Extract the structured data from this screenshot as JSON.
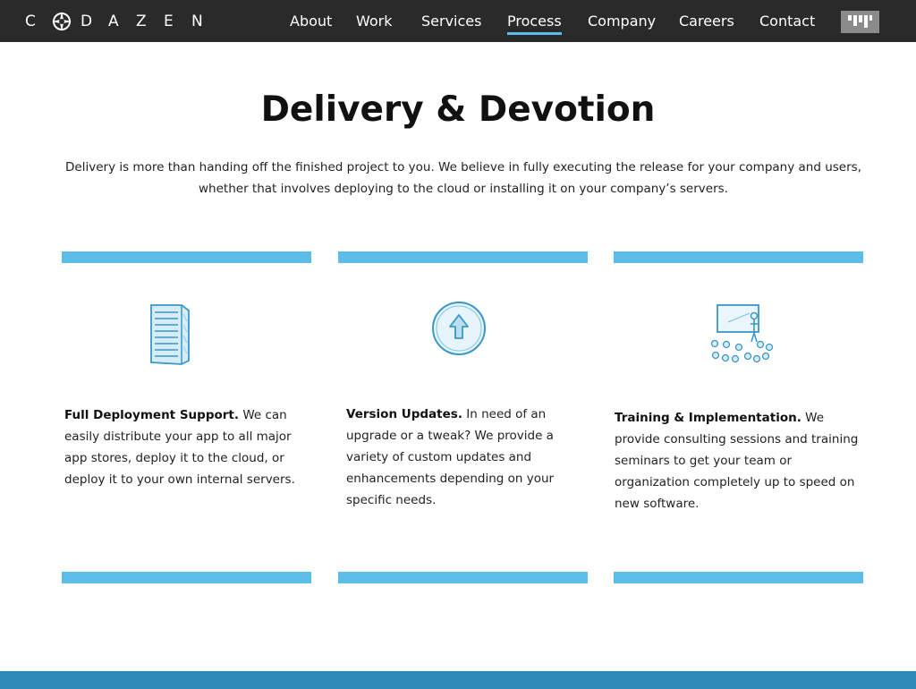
{
  "header": {
    "logo_letters": [
      "C",
      "D",
      "A",
      "Z",
      "E",
      "N"
    ],
    "nav": [
      {
        "label": "About"
      },
      {
        "label": "Work"
      },
      {
        "label": "Services"
      },
      {
        "label": "Process",
        "active": true
      },
      {
        "label": "Company"
      },
      {
        "label": "Careers"
      },
      {
        "label": "Contact"
      }
    ],
    "badge_icon": "brand-badge-icon"
  },
  "main": {
    "title": "Delivery & Devotion",
    "intro": "Delivery is more than handing off the finished project to you. We believe in fully executing the release for your company and users, whether that involves deploying to the cloud or installing it on your company’s servers."
  },
  "cards": [
    {
      "icon": "server-icon",
      "heading": "Full Deployment Support.",
      "body": "We can easily distribute your app to all major app stores, deploy it to the cloud, or deploy it to your own internal servers."
    },
    {
      "icon": "upload-arrow-icon",
      "heading": "Version Updates.",
      "body": "In need of an upgrade or a tweak? We provide a variety of custom updates and enhancements depending on your specific needs."
    },
    {
      "icon": "training-presentation-icon",
      "heading": "Training & Implementation.",
      "body": "We provide consulting sessions and training seminars to get your team or organization completely up to speed on new software."
    }
  ],
  "colors": {
    "header_bg": "#2a2a2a",
    "accent": "#5bbde8",
    "footer": "#2e8ab9"
  }
}
